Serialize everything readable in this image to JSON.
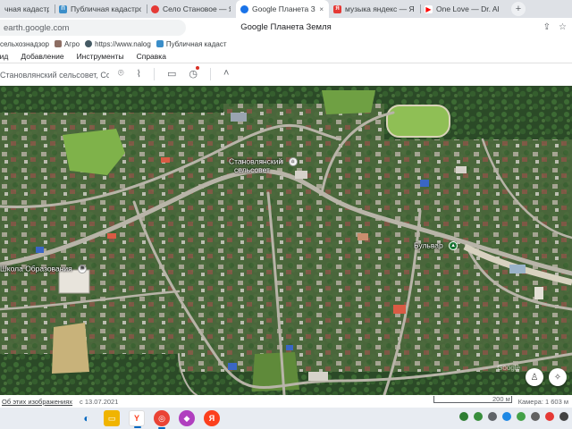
{
  "browser": {
    "tabs": [
      {
        "label": "чная кадастровая",
        "fav_color": "#4a7ab5",
        "fav_glyph": ""
      },
      {
        "label": "Публичная кадастрова",
        "fav_color": "#3b8ec9",
        "fav_glyph": "П"
      },
      {
        "label": "Село Становое — Янде",
        "fav_color": "#e53935",
        "fav_glyph": "●"
      },
      {
        "label": "Google Планета Земля",
        "fav_color": "#1a73e8",
        "fav_glyph": "●",
        "active": true
      },
      {
        "label": "музыка яндекс — Янде",
        "fav_color": "#e53935",
        "fav_glyph": "Я"
      },
      {
        "label": "One Love — Dr. Al",
        "fav_color": "#ff0000",
        "fav_glyph": "▶"
      }
    ],
    "close_glyph": "×",
    "new_tab_glyph": "+",
    "address": "earth.google.com",
    "page_title": "Google Планета Земля",
    "bookmarks": [
      {
        "label": "сельхознадзор",
        "color": "#7cb342"
      },
      {
        "label": "Агро",
        "color": "#8d6e63"
      },
      {
        "label": "https://www.nalog",
        "color": "#455a64"
      },
      {
        "label": "Публичная кадаст",
        "color": "#3b8ec9"
      }
    ]
  },
  "earth": {
    "menu": [
      "Вид",
      "Добавление",
      "Инструменты",
      "Справка"
    ],
    "search_value": "Становлянский сельсовет, Сове",
    "labels": {
      "selsovet_line1": "Становлянский",
      "selsovet_line2": "сельсовет",
      "school": "Школа Образования",
      "boulevard": "Бульвар"
    },
    "watermark": "Google",
    "status": {
      "about": "Об этих изображениях",
      "date": "с 13.07.2021",
      "scale": "200 м",
      "camera": "Камера: 1 603 м"
    }
  },
  "colors": {
    "accent": "#1a73e8",
    "map_base": "#2f4a2a"
  }
}
